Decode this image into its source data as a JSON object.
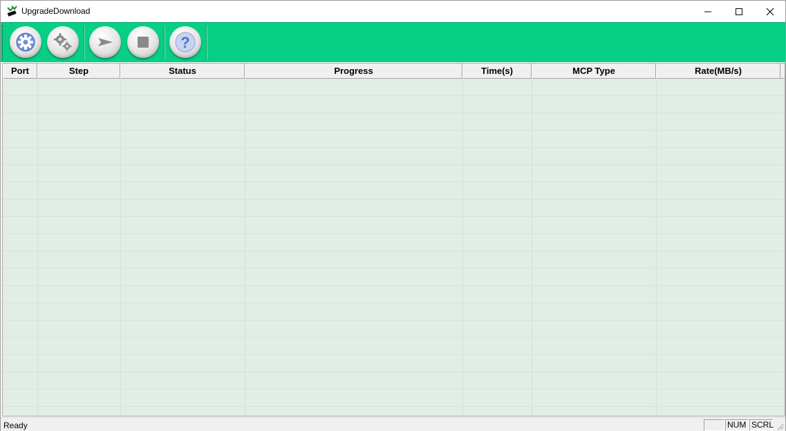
{
  "window": {
    "title": "UpgradeDownload"
  },
  "toolbar": {
    "buttons": [
      {
        "icon": "gear-icon"
      },
      {
        "icon": "gears-icon"
      },
      {
        "icon": "play-icon"
      },
      {
        "icon": "stop-icon"
      },
      {
        "icon": "help-icon"
      }
    ]
  },
  "table": {
    "columns": [
      "Port",
      "Step",
      "Status",
      "Progress",
      "Time(s)",
      "MCP Type",
      "Rate(MB/s)"
    ],
    "rows": []
  },
  "statusbar": {
    "text": "Ready",
    "pane_blank": "",
    "pane_num": "NUM",
    "pane_scrl": "SCRL"
  },
  "colors": {
    "toolbar_bg": "#07cf85",
    "list_bg": "#e2ede5"
  }
}
